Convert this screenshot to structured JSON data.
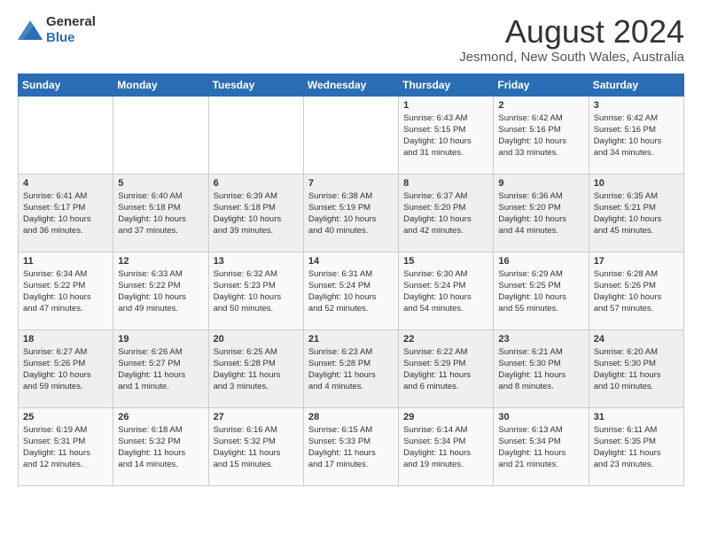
{
  "header": {
    "logo_general": "General",
    "logo_blue": "Blue",
    "title": "August 2024",
    "subtitle": "Jesmond, New South Wales, Australia"
  },
  "calendar": {
    "weekdays": [
      "Sunday",
      "Monday",
      "Tuesday",
      "Wednesday",
      "Thursday",
      "Friday",
      "Saturday"
    ],
    "weeks": [
      [
        {
          "day": "",
          "info": ""
        },
        {
          "day": "",
          "info": ""
        },
        {
          "day": "",
          "info": ""
        },
        {
          "day": "",
          "info": ""
        },
        {
          "day": "1",
          "info": "Sunrise: 6:43 AM\nSunset: 5:15 PM\nDaylight: 10 hours\nand 31 minutes."
        },
        {
          "day": "2",
          "info": "Sunrise: 6:42 AM\nSunset: 5:16 PM\nDaylight: 10 hours\nand 33 minutes."
        },
        {
          "day": "3",
          "info": "Sunrise: 6:42 AM\nSunset: 5:16 PM\nDaylight: 10 hours\nand 34 minutes."
        }
      ],
      [
        {
          "day": "4",
          "info": "Sunrise: 6:41 AM\nSunset: 5:17 PM\nDaylight: 10 hours\nand 36 minutes."
        },
        {
          "day": "5",
          "info": "Sunrise: 6:40 AM\nSunset: 5:18 PM\nDaylight: 10 hours\nand 37 minutes."
        },
        {
          "day": "6",
          "info": "Sunrise: 6:39 AM\nSunset: 5:18 PM\nDaylight: 10 hours\nand 39 minutes."
        },
        {
          "day": "7",
          "info": "Sunrise: 6:38 AM\nSunset: 5:19 PM\nDaylight: 10 hours\nand 40 minutes."
        },
        {
          "day": "8",
          "info": "Sunrise: 6:37 AM\nSunset: 5:20 PM\nDaylight: 10 hours\nand 42 minutes."
        },
        {
          "day": "9",
          "info": "Sunrise: 6:36 AM\nSunset: 5:20 PM\nDaylight: 10 hours\nand 44 minutes."
        },
        {
          "day": "10",
          "info": "Sunrise: 6:35 AM\nSunset: 5:21 PM\nDaylight: 10 hours\nand 45 minutes."
        }
      ],
      [
        {
          "day": "11",
          "info": "Sunrise: 6:34 AM\nSunset: 5:22 PM\nDaylight: 10 hours\nand 47 minutes."
        },
        {
          "day": "12",
          "info": "Sunrise: 6:33 AM\nSunset: 5:22 PM\nDaylight: 10 hours\nand 49 minutes."
        },
        {
          "day": "13",
          "info": "Sunrise: 6:32 AM\nSunset: 5:23 PM\nDaylight: 10 hours\nand 50 minutes."
        },
        {
          "day": "14",
          "info": "Sunrise: 6:31 AM\nSunset: 5:24 PM\nDaylight: 10 hours\nand 52 minutes."
        },
        {
          "day": "15",
          "info": "Sunrise: 6:30 AM\nSunset: 5:24 PM\nDaylight: 10 hours\nand 54 minutes."
        },
        {
          "day": "16",
          "info": "Sunrise: 6:29 AM\nSunset: 5:25 PM\nDaylight: 10 hours\nand 55 minutes."
        },
        {
          "day": "17",
          "info": "Sunrise: 6:28 AM\nSunset: 5:26 PM\nDaylight: 10 hours\nand 57 minutes."
        }
      ],
      [
        {
          "day": "18",
          "info": "Sunrise: 6:27 AM\nSunset: 5:26 PM\nDaylight: 10 hours\nand 59 minutes."
        },
        {
          "day": "19",
          "info": "Sunrise: 6:26 AM\nSunset: 5:27 PM\nDaylight: 11 hours\nand 1 minute."
        },
        {
          "day": "20",
          "info": "Sunrise: 6:25 AM\nSunset: 5:28 PM\nDaylight: 11 hours\nand 3 minutes."
        },
        {
          "day": "21",
          "info": "Sunrise: 6:23 AM\nSunset: 5:28 PM\nDaylight: 11 hours\nand 4 minutes."
        },
        {
          "day": "22",
          "info": "Sunrise: 6:22 AM\nSunset: 5:29 PM\nDaylight: 11 hours\nand 6 minutes."
        },
        {
          "day": "23",
          "info": "Sunrise: 6:21 AM\nSunset: 5:30 PM\nDaylight: 11 hours\nand 8 minutes."
        },
        {
          "day": "24",
          "info": "Sunrise: 6:20 AM\nSunset: 5:30 PM\nDaylight: 11 hours\nand 10 minutes."
        }
      ],
      [
        {
          "day": "25",
          "info": "Sunrise: 6:19 AM\nSunset: 5:31 PM\nDaylight: 11 hours\nand 12 minutes."
        },
        {
          "day": "26",
          "info": "Sunrise: 6:18 AM\nSunset: 5:32 PM\nDaylight: 11 hours\nand 14 minutes."
        },
        {
          "day": "27",
          "info": "Sunrise: 6:16 AM\nSunset: 5:32 PM\nDaylight: 11 hours\nand 15 minutes."
        },
        {
          "day": "28",
          "info": "Sunrise: 6:15 AM\nSunset: 5:33 PM\nDaylight: 11 hours\nand 17 minutes."
        },
        {
          "day": "29",
          "info": "Sunrise: 6:14 AM\nSunset: 5:34 PM\nDaylight: 11 hours\nand 19 minutes."
        },
        {
          "day": "30",
          "info": "Sunrise: 6:13 AM\nSunset: 5:34 PM\nDaylight: 11 hours\nand 21 minutes."
        },
        {
          "day": "31",
          "info": "Sunrise: 6:11 AM\nSunset: 5:35 PM\nDaylight: 11 hours\nand 23 minutes."
        }
      ]
    ]
  }
}
